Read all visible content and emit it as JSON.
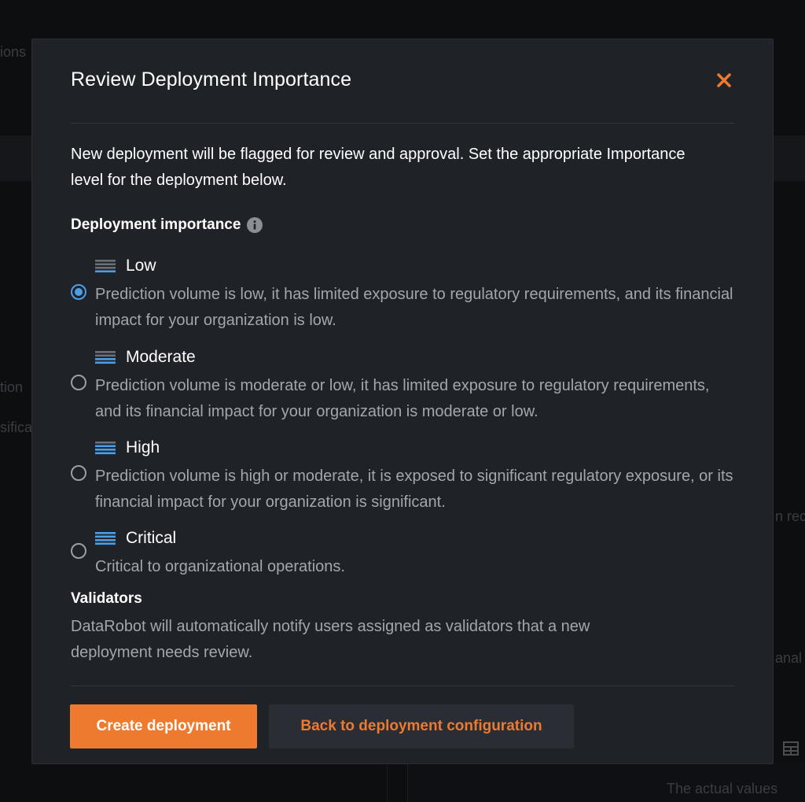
{
  "modal": {
    "title": "Review Deployment Importance",
    "intro": "New deployment will be flagged for review and approval. Set the appropriate Importance level for the deployment below.",
    "importance_label": "Deployment importance",
    "options": [
      {
        "name": "Low",
        "description": "Prediction volume is low, it has limited exposure to regulatory requirements, and its financial impact for your organization is low.",
        "selected": true,
        "active_bars": 1
      },
      {
        "name": "Moderate",
        "description": "Prediction volume is moderate or low, it has limited exposure to regulatory requirements, and its financial impact for your organization is moderate or low.",
        "selected": false,
        "active_bars": 2
      },
      {
        "name": "High",
        "description": "Prediction volume is high or moderate, it is exposed to significant regulatory exposure, or its financial impact for your organization is significant.",
        "selected": false,
        "active_bars": 3
      },
      {
        "name": "Critical",
        "description": "Critical to organizational operations.",
        "selected": false,
        "active_bars": 4
      }
    ],
    "validators_title": "Validators",
    "validators_desc": "DataRobot will automatically notify users assigned as validators that a new deployment needs review.",
    "primary_button": "Create deployment",
    "secondary_button": "Back to deployment configuration"
  },
  "background": {
    "fragments": [
      "ions",
      "tion",
      "sifica",
      "n rec",
      "anal",
      "The actual values"
    ]
  },
  "colors": {
    "accent": "#ed7a2e",
    "radio_selected": "#4a9fe8",
    "level_active": "#4a9fe8",
    "level_inactive": "#6b6f76",
    "modal_bg": "#1f2227"
  }
}
